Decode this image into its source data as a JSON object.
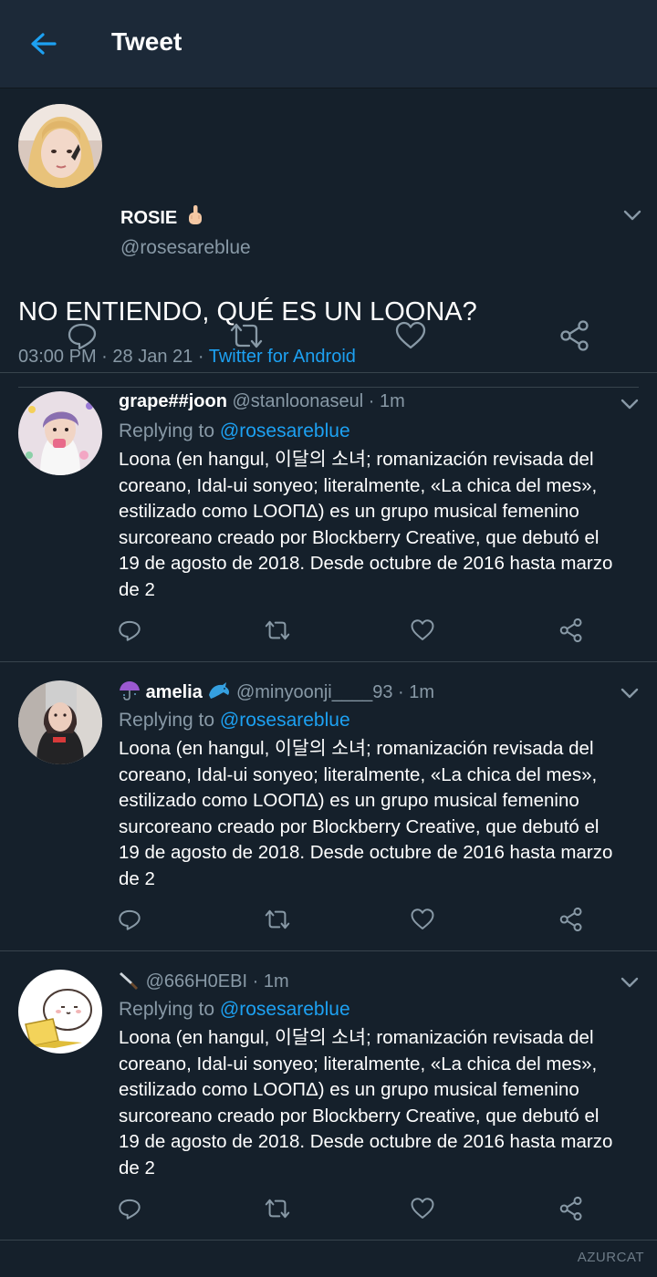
{
  "header": {
    "title": "Tweet",
    "back_icon": "back-arrow-icon",
    "accent": "#1da1f2"
  },
  "main_tweet": {
    "name": "ROSIE",
    "name_emoji": "middle-finger-emoji",
    "handle": "@rosesareblue",
    "text": "NO ENTIENDO, QUÉ ES UN LOONA?",
    "time": "03:00 PM",
    "date": "28 Jan 21",
    "separator": "·",
    "source": "Twitter for Android",
    "actions": [
      "reply-icon",
      "retweet-icon",
      "like-icon",
      "share-icon"
    ]
  },
  "replies": [
    {
      "name": "grape##joon",
      "handle": "@stanloonaseul",
      "time": "1m",
      "replying_label": "Replying to",
      "replying_to": "@rosesareblue",
      "body": "Loona (en hangul, 이달의 소녀; romanización revisada del\ncoreano, Idal-ui sonyeo; literalmente, «La chica del mes»,\nestilizado como LOOΠΔ) es un grupo musical femenino\nsurcoreano creado por Blockberry Creative, que debutó el\n19 de agosto de 2018. Desde octubre de 2016 hasta marzo\nde 2"
    },
    {
      "name_prefix_emoji": "umbrella-emoji",
      "name": "amelia",
      "name_suffix_emoji": "dolphin-emoji",
      "handle": "@minyoonji____93",
      "time": "1m",
      "replying_label": "Replying to",
      "replying_to": "@rosesareblue",
      "body": "Loona (en hangul, 이달의 소녀; romanización revisada del\ncoreano, Idal-ui sonyeo; literalmente, «La chica del mes»,\nestilizado como LOOΠΔ) es un grupo musical femenino\nsurcoreano creado por Blockberry Creative, que debutó el\n19 de agosto de 2018. Desde octubre de 2016 hasta marzo\nde 2"
    },
    {
      "name_prefix_emoji": "knife-emoji",
      "name": "",
      "handle": "@666H0EBI",
      "time": "1m",
      "replying_label": "Replying to",
      "replying_to": "@rosesareblue",
      "body": "Loona (en hangul, 이달의 소녀; romanización revisada del\ncoreano, Idal-ui sonyeo; literalmente, «La chica del mes»,\nestilizado como LOOΠΔ) es un grupo musical femenino\nsurcoreano creado por Blockberry Creative, que debutó el\n19 de agosto de 2018. Desde octubre de 2016 hasta marzo\nde 2"
    }
  ],
  "watermark": "AZURCAT",
  "colors": {
    "background": "#15202b",
    "header_bg": "#1c2938",
    "secondary_text": "#8899a6",
    "divider": "#38444d",
    "link": "#1da1f2"
  }
}
